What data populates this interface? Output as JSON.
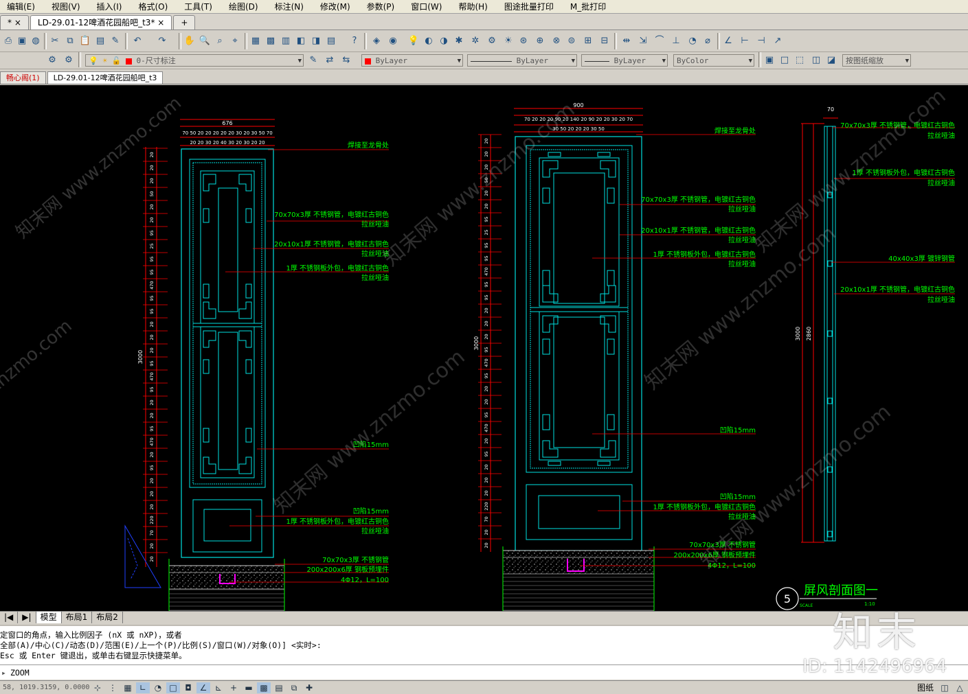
{
  "menu": [
    "编辑(E)",
    "视图(V)",
    "插入(I)",
    "格式(O)",
    "工具(T)",
    "绘图(D)",
    "标注(N)",
    "修改(M)",
    "参数(P)",
    "窗口(W)",
    "帮助(H)",
    "图途批量打印",
    "M_批打印"
  ],
  "doc_tabs": [
    "*",
    "LD-29.01-12啤酒花园船吧_t3*"
  ],
  "toolbar": {
    "layer_value": "0-尺寸标注",
    "color_value": "ByLayer",
    "linetype_value": "ByLayer",
    "lineweight_value": "ByLayer",
    "plotstyle_value": "ByColor",
    "scale_value": "按图纸缩放"
  },
  "layout_tabs": [
    "畅心阁(1)",
    "LD-29.01-12啤酒花园船吧_t3"
  ],
  "sheet_tabs": [
    "模型",
    "布局1",
    "布局2"
  ],
  "drawing": {
    "left": {
      "overall_width": "676",
      "top_dims_1": "70 50 20 20 20 20 20 30 20 30 50 70",
      "top_dims_2": "20 20 30 20 40 30 20 30 20 20",
      "height": "3000",
      "dims": [
        "20",
        "20",
        "20",
        "50",
        "20",
        "20",
        "95",
        "25",
        "95",
        "95",
        "470",
        "95",
        "95",
        "20",
        "20",
        "20",
        "95",
        "470",
        "95",
        "20",
        "20",
        "95",
        "470",
        "20",
        "95",
        "20",
        "20",
        "20",
        "220",
        "70",
        "20",
        "20"
      ],
      "labels": [
        "焊接至龙骨处",
        "70x70x3厚 不锈钢管，电镀红古铜色",
        "拉丝哑油",
        "20x10x1厚 不锈钢管，电镀红古铜色",
        "拉丝哑油",
        "1厚 不锈钢板外包，电镀红古铜色",
        "拉丝哑油",
        "凹陷15mm",
        "凹陷15mm",
        "1厚 不锈钢板外包，电镀红古铜色",
        "拉丝哑油",
        "70x70x3厚 不锈钢管",
        "200x200x6厚 钢板预埋件",
        "4Φ12，L=100"
      ]
    },
    "middle": {
      "overall_width": "900",
      "top_dims_1": "70 20 20 20 90 20 140 20 90 20 20 30 20 70",
      "top_dims_2": "30 50 20 20 20 30 50",
      "height": "3000",
      "labels": [
        "焊接至龙骨处",
        "70x70x3厚 不锈钢管，电镀红古铜色",
        "拉丝哑油",
        "20x10x1厚 不锈钢管，电镀红古铜色",
        "拉丝哑油",
        "1厚 不锈钢板外包，电镀红古铜色",
        "拉丝哑油",
        "凹陷15mm",
        "凹陷15mm",
        "1厚 不锈钢板外包，电镀红古铜色",
        "拉丝哑油",
        "70x70x3厚 不锈钢管",
        "200x200x6厚 钢板预埋件",
        "4Φ12，L=100"
      ]
    },
    "right": {
      "top_width": "70",
      "height_outer": "3000",
      "height_inner": "2860",
      "labels": [
        "70x70x3厚 不锈钢管，电镀红古铜色",
        "拉丝哑油",
        "1厚 不锈钢板外包，电镀红古铜色",
        "拉丝哑油",
        "40x40x3厚 镀锌钢管",
        "20x10x1厚 不锈钢管，电镀红古铜色",
        "拉丝哑油"
      ],
      "section_number": "5",
      "section_title": "屏风剖面图一",
      "section_scale_left": "SCALE",
      "section_scale_right": "1:10"
    }
  },
  "watermarks": [
    "知末网 www.znzmo.com",
    "znzmo.com"
  ],
  "brand_logo": "知末",
  "brand_id": "ID: 1142496964",
  "command_history": [
    "定窗口的角点，输入比例因子 (nX 或 nXP)，或者",
    "全部(A)/中心(C)/动态(D)/范围(E)/上一个(P)/比例(S)/窗口(W)/对象(O)] <实时>:",
    " Esc 或 Enter 键退出，或单击右键显示快捷菜单。"
  ],
  "command_input": "ZOOM",
  "status": {
    "coords": "58, 1019.3159, 0.0000",
    "paper_label": "图纸"
  }
}
